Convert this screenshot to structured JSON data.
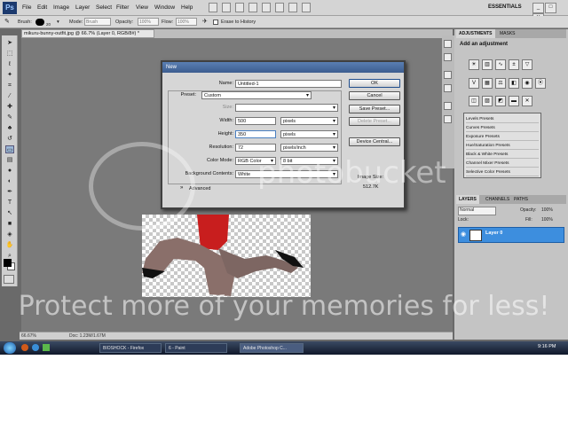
{
  "menubar": {
    "items": [
      "File",
      "Edit",
      "Image",
      "Layer",
      "Select",
      "Filter",
      "View",
      "Window",
      "Help"
    ],
    "workspace": "ESSENTIALS",
    "window_buttons": [
      "_",
      "□",
      "✕"
    ]
  },
  "options_bar": {
    "brush_label": "Brush:",
    "brush_size": "20",
    "mode_label": "Mode:",
    "mode_value": "Brush",
    "opacity_label": "Opacity:",
    "opacity_value": "100%",
    "flow_label": "Flow:",
    "flow_value": "100%",
    "erase_history": "Erase to History"
  },
  "document_tab": "mikuru-bunny-outfit.jpg @ 66.7% (Layer 0, RGB/8#) *",
  "statusbar": {
    "zoom": "66.67%",
    "doc": "Doc: 1.23M/1.67M"
  },
  "dialog": {
    "title": "New",
    "name_label": "Name:",
    "name_value": "Untitled-1",
    "preset_label": "Preset:",
    "preset_value": "Custom",
    "size_label": "Size:",
    "width_label": "Width:",
    "width_value": "500",
    "width_unit": "pixels",
    "height_label": "Height:",
    "height_value": "350",
    "height_unit": "pixels",
    "resolution_label": "Resolution:",
    "resolution_value": "72",
    "resolution_unit": "pixels/inch",
    "color_mode_label": "Color Mode:",
    "color_mode_value": "RGB Color",
    "bit_depth": "8 bit",
    "bg_label": "Background Contents:",
    "bg_value": "White",
    "advanced": "Advanced",
    "ok": "OK",
    "cancel": "Cancel",
    "save_preset": "Save Preset...",
    "delete_preset": "Delete Preset...",
    "device_central": "Device Central...",
    "image_size_label": "Image Size:",
    "image_size_value": "512.7K"
  },
  "adjustments_panel": {
    "tabs": [
      "ADJUSTMENTS",
      "MASKS"
    ],
    "title": "Add an adjustment",
    "presets": [
      "Levels Presets",
      "Curves Presets",
      "Exposure Presets",
      "Hue/Saturation Presets",
      "Black & White Presets",
      "Channel Mixer Presets",
      "Selective Color Presets"
    ]
  },
  "layers_panel": {
    "tabs": [
      "LAYERS",
      "CHANNELS",
      "PATHS"
    ],
    "blend_mode": "Normal",
    "opacity_label": "Opacity:",
    "opacity_value": "100%",
    "lock_label": "Lock:",
    "fill_label": "Fill:",
    "fill_value": "100%",
    "layer_name": "Layer 0"
  },
  "taskbar": {
    "tasks": [
      "BIOSHOCK - Firefox",
      "6 - Paint",
      "Adobe Photoshop C..."
    ],
    "clock": "9:16 PM"
  },
  "watermark": {
    "center": "photobucket",
    "bottom": "Protect more of your memories for less!"
  },
  "colors": {
    "title_bar": "#3c5d8f",
    "layer_selected": "#3d8ede",
    "taskbar": "#10182a"
  }
}
